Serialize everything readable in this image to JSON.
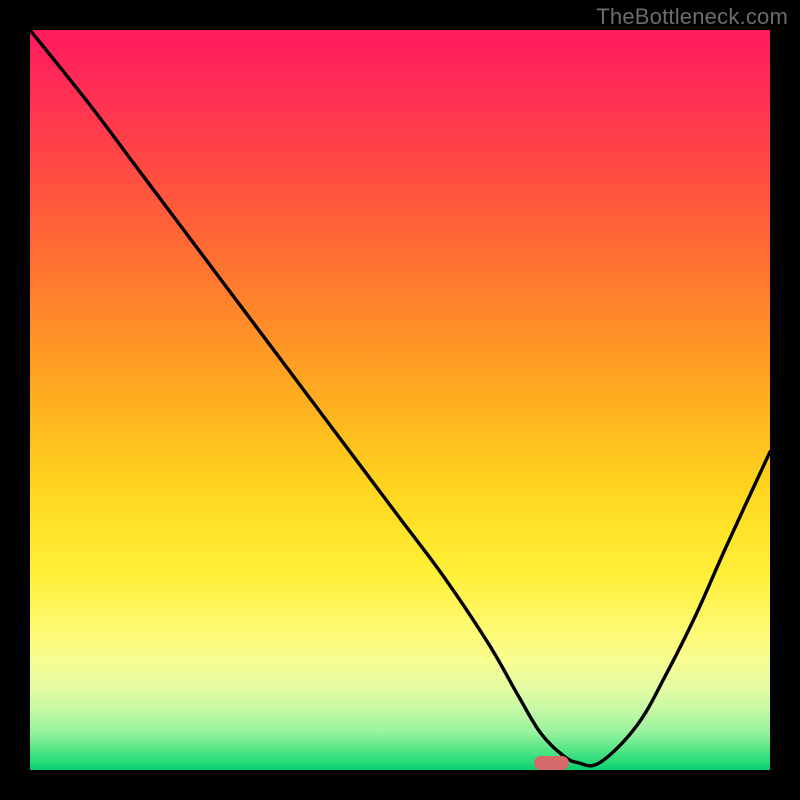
{
  "watermark": "TheBottleneck.com",
  "chart_data": {
    "type": "line",
    "title": "",
    "xlabel": "",
    "ylabel": "",
    "xlim": [
      0,
      100
    ],
    "ylim": [
      0,
      100
    ],
    "grid": false,
    "line_color": "#000000",
    "line_width": 3.4,
    "x": [
      0,
      8,
      14,
      20,
      26,
      32,
      38,
      44,
      50,
      56,
      62,
      66,
      69,
      72,
      74,
      77,
      82,
      86,
      90,
      94,
      100
    ],
    "values": [
      100,
      90,
      82,
      74,
      66,
      58,
      50,
      42,
      34,
      26,
      17,
      10,
      5,
      2,
      1,
      1,
      6,
      13,
      21,
      30,
      43
    ],
    "marker": {
      "x": 70.5,
      "y": 1.0,
      "color": "#d46a6a",
      "width_pct": 4.8,
      "height_pct": 1.9
    }
  }
}
